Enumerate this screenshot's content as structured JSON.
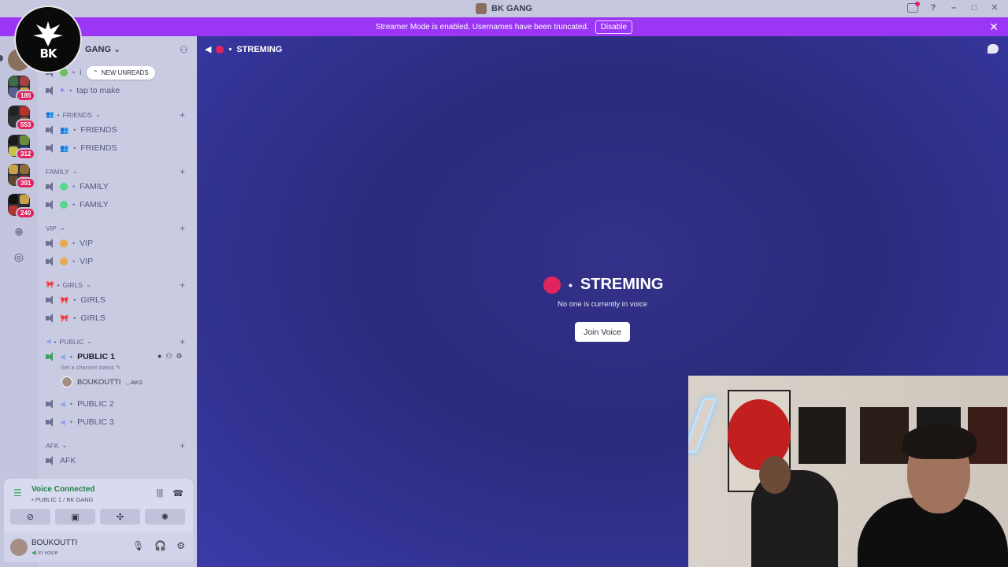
{
  "window": {
    "title": "BK GANG"
  },
  "banner": {
    "message": "Streamer Mode is enabled. Usernames have been truncated.",
    "disable_label": "Disable"
  },
  "logo": {
    "text": "BK"
  },
  "server": {
    "name": "GANG",
    "new_unreads": "NEW UNREADS"
  },
  "servers": [
    {
      "badge": "185"
    },
    {
      "badge": "553"
    },
    {
      "badge": "312"
    },
    {
      "badge": "391"
    },
    {
      "badge": "240"
    }
  ],
  "channels": {
    "top_partial": "i",
    "tap_to_make": "tap to make",
    "categories": {
      "friends": "FRIENDS",
      "family": "FAMILY",
      "vip": "VIP",
      "girls": "GIRLS",
      "public": "PUBLIC",
      "afk": "AFK"
    },
    "friends": [
      "FRIENDS",
      "FRIENDS"
    ],
    "family": [
      "FAMILY",
      "FAMILY"
    ],
    "vip": [
      "VIP",
      "VIP"
    ],
    "girls": [
      "GIRLS",
      "GIRLS"
    ],
    "public": [
      "PUBLIC 1",
      "PUBLIC 2",
      "PUBLIC 3"
    ],
    "afk": [
      "AFK"
    ],
    "status_hint": "Set a channel status",
    "member_name": "BOUKOUTTI",
    "member_tag": "AKS"
  },
  "voice": {
    "title": "Voice Connected",
    "location": "PUBLIC 1 / BK GANG"
  },
  "user": {
    "name": "BOUKOUTTI",
    "status": "In voice"
  },
  "main": {
    "channel_name": "STREMING",
    "empty_text": "No one is currently in voice",
    "join_label": "Join Voice"
  },
  "colors": {
    "accent_banner": "#9b36f5",
    "main_bg": "#2a2a7a",
    "rec_dot": "#e0245e",
    "voice_green": "#3ba55d"
  }
}
